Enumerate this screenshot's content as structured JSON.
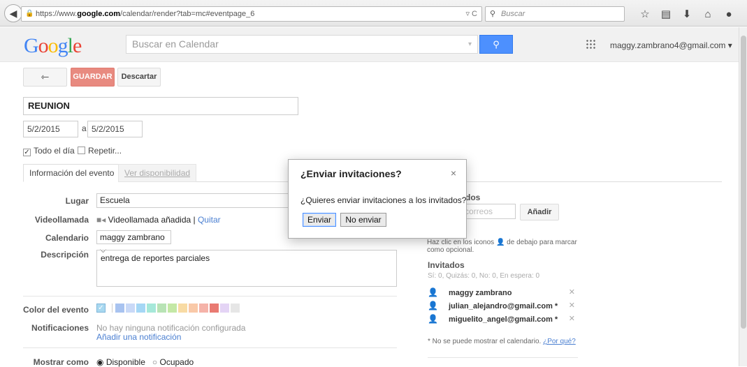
{
  "browser": {
    "url_prefix": "https://www.",
    "url_domain": "google.com",
    "url_path": "/calendar/render?tab=mc#eventpage_6",
    "search_placeholder": "Buscar"
  },
  "header": {
    "logo_letters": [
      "G",
      "o",
      "o",
      "g",
      "l",
      "e"
    ],
    "search_placeholder": "Buscar en Calendar",
    "account": "maggy.zambrano4@gmail.com ▾"
  },
  "actions": {
    "back": "⇽",
    "save": "GUARDAR",
    "discard": "Descartar"
  },
  "event": {
    "title": "REUNION",
    "start_date": "5/2/2015",
    "to": "a",
    "end_date": "5/2/2015",
    "all_day_label": "Todo el día",
    "repeat_label": "Repetir..."
  },
  "tabs": {
    "info": "Información del evento",
    "availability": "Ver disponibilidad"
  },
  "details": {
    "place_label": "Lugar",
    "place_value": "Escuela",
    "video_label": "Videollamada",
    "video_value": "Videollamada añadida",
    "video_sep": " | ",
    "video_remove": "Quitar",
    "calendar_label": "Calendario",
    "calendar_value": "maggy zambrano",
    "description_label": "Descripción",
    "description_value": "entrega de reportes parciales",
    "color_label": "Color del evento",
    "notifications_label": "Notificaciones",
    "notifications_value": "No hay ninguna notificación configurada",
    "add_notification": "Añadir una notificación",
    "show_as_label": "Mostrar como",
    "available": "Disponible",
    "busy": "Ocupado"
  },
  "colors": [
    "#a4bdfc",
    "#c5d6fb",
    "#7ae7bf",
    "#dbadff",
    "#ff887c",
    "#fbd75b",
    "#ffb878",
    "#46d6db",
    "#e1e1e1",
    "#5484ed",
    "#51b749",
    "#dc2127"
  ],
  "swatch_colors": [
    "#a8c3f0",
    "#c9d9f7",
    "#a5d7f5",
    "#a6e8d9",
    "#b8e3b5",
    "#c4e8a6",
    "#f8dba4",
    "#f9c9a8",
    "#f5b3a9",
    "#e97a72",
    "#e4d4f5",
    "#e6e6e6"
  ],
  "guests_panel": {
    "title_partial": "itados",
    "email_placeholder_partial": "os correos",
    "add_button": "Añadir",
    "hint": "Haz clic en los iconos",
    "hint_rest": "de debajo para marcar como opcional.",
    "invited_title": "Invitados",
    "counts": "Sí: 0, Quizás: 0, No: 0, En espera: 0",
    "guests": [
      {
        "name": "maggy zambrano"
      },
      {
        "name": "julian_alejandro@gmail.com *"
      },
      {
        "name": "miguelito_angel@gmail.com *"
      }
    ],
    "footnote": "* No se puede mostrar el calendario.",
    "footnote_link": "¿Por qué?"
  },
  "dialog": {
    "title": "¿Enviar invitaciones?",
    "close": "×",
    "message": "¿Quieres enviar invitaciones a los invitados?",
    "send": "Enviar",
    "dont_send": "No enviar"
  }
}
